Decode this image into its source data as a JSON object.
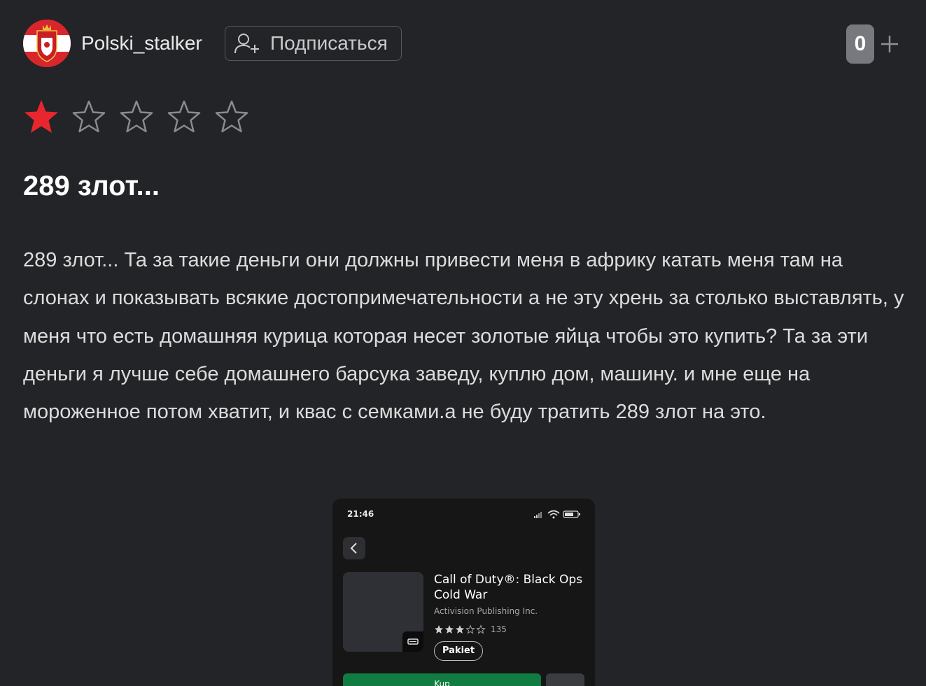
{
  "header": {
    "username": "Polski_stalker",
    "subscribe_label": "Подписаться",
    "score": "0"
  },
  "rating": {
    "value": 1,
    "max": 5,
    "filled_color": "#e8262e",
    "empty_color": "#8a8b8f"
  },
  "review": {
    "title": "289 злот...",
    "body": "289 злот... Та за такие деньги они должны привести меня в африку катать меня там на слонах и показывать всякие достопримечательности а не эту хрень за столько выставлять, у меня что есть домашняя курица которая несет золотые яйца чтобы это купить? Та за эти деньги я лучше себе домашнего барсука заведу, куплю дом, машину. и мне еще на мороженное потом хватит, и квас с семками.а не буду тратить 289 злот на это."
  },
  "attachment": {
    "time": "21:46",
    "game_title": "Call of Duty®: Black Ops Cold War",
    "publisher": "Activision Publishing Inc.",
    "app_rating": 3,
    "rating_count": "135",
    "pill_label": "Pakiet",
    "buy_label": "Kup",
    "buy_color": "#107c41"
  }
}
